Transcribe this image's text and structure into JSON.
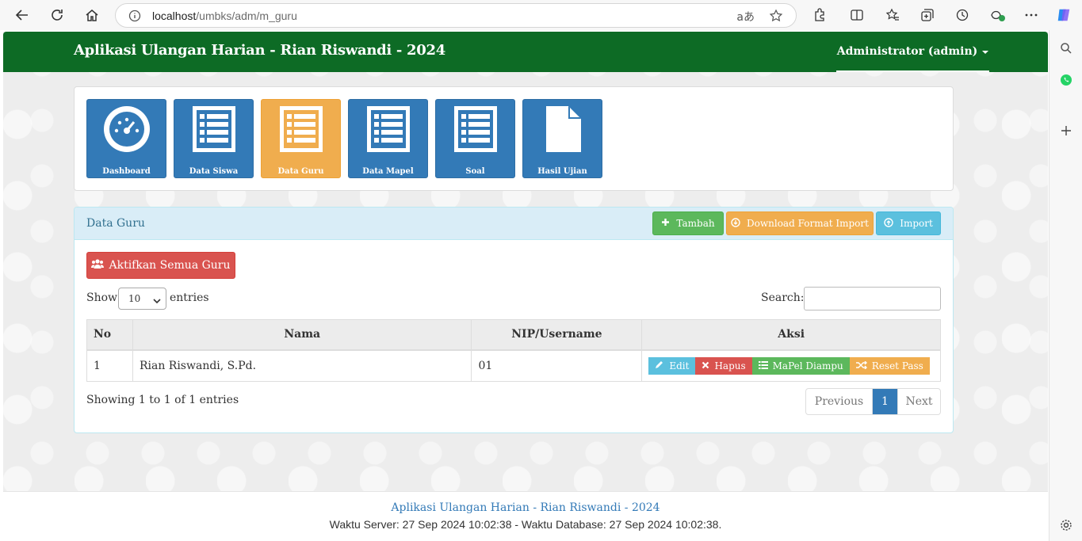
{
  "browser": {
    "url_host": "localhost",
    "url_path": "/umbks/adm/m_guru",
    "read_aloud_glyph": "aあ"
  },
  "app": {
    "title": "Aplikasi Ulangan Harian - Rian Riswandi - 2024",
    "user_menu": "Administrator (admin)",
    "brand_color": "#0d6b25"
  },
  "menu": {
    "tiles": [
      {
        "label": "Dashboard",
        "icon": "dashboard-icon",
        "active": false
      },
      {
        "label": "Data Siswa",
        "icon": "list-icon",
        "active": false
      },
      {
        "label": "Data Guru",
        "icon": "list-icon",
        "active": true
      },
      {
        "label": "Data Mapel",
        "icon": "list-icon",
        "active": false
      },
      {
        "label": "Soal",
        "icon": "list-icon",
        "active": false
      },
      {
        "label": "Hasil Ujian",
        "icon": "file-icon",
        "active": false
      }
    ]
  },
  "panel": {
    "title": "Data Guru",
    "add_label": "Tambah",
    "download_label": "Download Format Import",
    "import_label": "Import",
    "activate_all_label": "Aktifkan Semua Guru",
    "show_label": "Show",
    "entries_label": "entries",
    "page_length": "10",
    "search_label": "Search:",
    "search_value": ""
  },
  "table": {
    "columns": [
      "No",
      "Nama",
      "NIP/Username",
      "Aksi"
    ],
    "rows": [
      {
        "no": "1",
        "nama": "Rian Riswandi, S.Pd.",
        "nip": "01"
      }
    ],
    "actions": {
      "edit": "Edit",
      "delete": "Hapus",
      "subjects": "MaPel Diampu",
      "reset": "Reset Pass"
    },
    "info": "Showing 1 to 1 of 1 entries"
  },
  "pagination": {
    "previous": "Previous",
    "current": "1",
    "next": "Next"
  },
  "footer": {
    "line1": "Aplikasi Ulangan Harian - Rian Riswandi - 2024",
    "line2": "Waktu Server: 27 Sep 2024 10:02:38 - Waktu Database: 27 Sep 2024 10:02:38."
  }
}
